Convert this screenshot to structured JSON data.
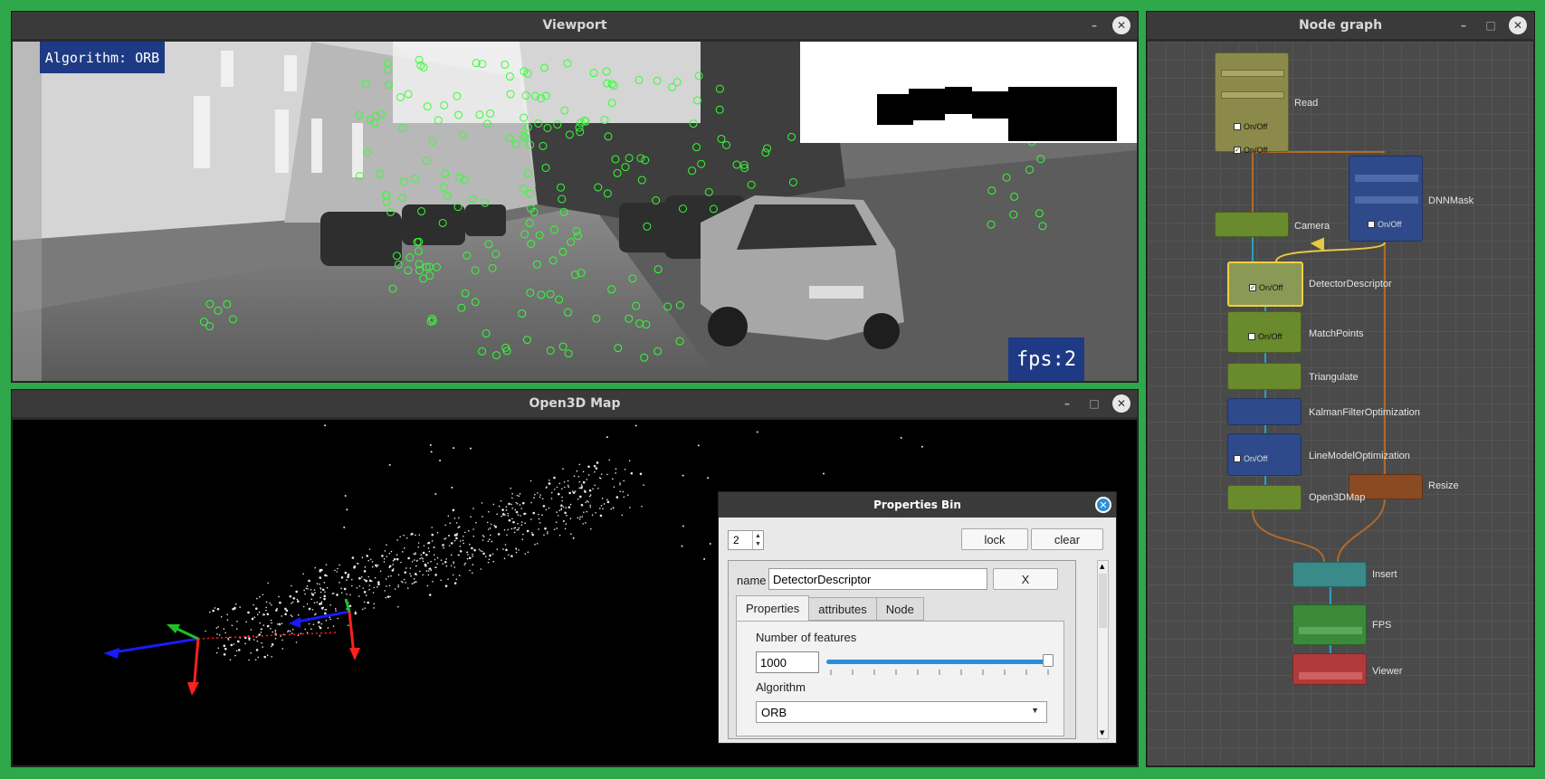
{
  "viewport": {
    "title": "Viewport",
    "algorithm_label": "Algorithm: ORB",
    "fps_label": "fps:2",
    "minimize": "–",
    "close": "✕"
  },
  "open3d": {
    "title": "Open3D Map",
    "minimize": "–",
    "maximize": "□",
    "close": "✕"
  },
  "properties_bin": {
    "title": "Properties Bin",
    "close": "✕",
    "spin_value": "2",
    "lock_label": "lock",
    "clear_label": "clear",
    "name_label": "name",
    "name_value": "DetectorDescriptor",
    "x_label": "X",
    "tabs": [
      "Properties",
      "attributes",
      "Node"
    ],
    "num_features_label": "Number of features",
    "num_features_value": "1000",
    "slider_fraction": 0.98,
    "algorithm_label": "Algorithm",
    "algorithm_value": "ORB"
  },
  "node_graph": {
    "title": "Node graph",
    "minimize": "–",
    "maximize": "□",
    "close": "✕",
    "nodes": {
      "read": "Read",
      "camera": "Camera",
      "dnnmask": "DNNMask",
      "detector": "DetectorDescriptor",
      "match": "MatchPoints",
      "triangulate": "Triangulate",
      "kalman": "KalmanFilterOptimization",
      "linemodel": "LineModelOptimization",
      "resize": "Resize",
      "open3dmap": "Open3DMap",
      "insert": "Insert",
      "fps": "FPS",
      "viewer": "Viewer"
    },
    "onoff": "On/Off"
  },
  "colors": {
    "desktop": "#2ea84a",
    "overlay_blue": "#1f3a84",
    "keypoint_green": "#33ff33",
    "accent_blue": "#2a8fd8"
  }
}
